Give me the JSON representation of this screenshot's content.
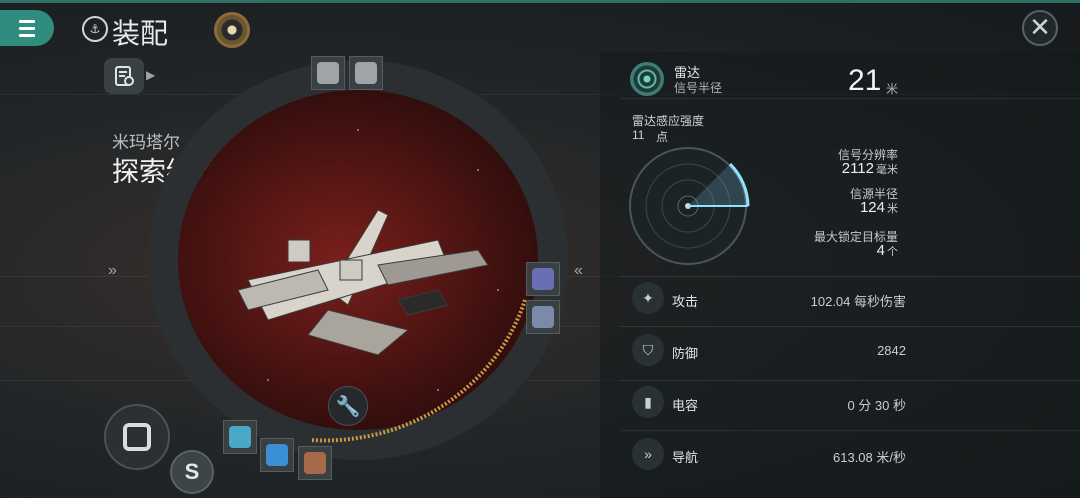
{
  "header": {
    "title": "装配",
    "title_icon": "fitting-emblem-icon",
    "close_symbol": "✕"
  },
  "ship": {
    "faction": "米玛塔尔",
    "name": "探索级隐匿型",
    "name_chevron": "»"
  },
  "side_chevrons": {
    "left": "»",
    "right": "«"
  },
  "radar": {
    "label": "雷达",
    "sublabel": "信号半径",
    "value": "21",
    "unit": "米",
    "sensor_strength_label": "雷达感应强度",
    "sensor_strength_value": "11",
    "sensor_strength_unit": "点"
  },
  "targeting": {
    "resolution_label": "信号分辨率",
    "resolution_value": "2112",
    "resolution_unit": "毫米",
    "range_label": "信源半径",
    "range_value": "124",
    "range_unit": "米",
    "max_targets_label": "最大锁定目标量",
    "max_targets_value": "4",
    "max_targets_unit": "个"
  },
  "attributes": [
    {
      "label": "攻击",
      "value": "102.04 每秒伤害",
      "icon": "turret-icon"
    },
    {
      "label": "防御",
      "value": "2842",
      "icon": "shield-icon"
    },
    {
      "label": "电容",
      "value": "0 分 30 秒",
      "icon": "capacitor-icon"
    },
    {
      "label": "导航",
      "value": "613.08 米/秒",
      "icon": "navigation-icon"
    }
  ],
  "colors": {
    "accent": "#2f8c7e",
    "gold": "#c79a45",
    "radar_cyan": "#8fe3ff"
  }
}
